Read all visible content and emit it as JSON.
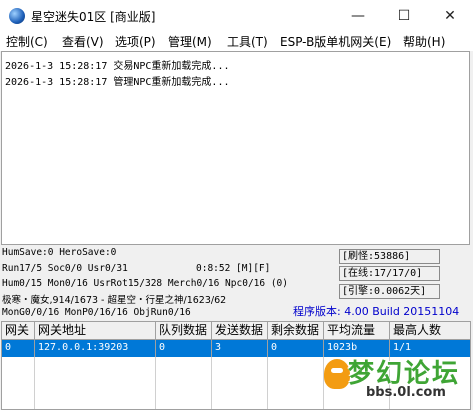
{
  "window": {
    "title": "星空迷失01区 [商业版]",
    "minimize_glyph": "—",
    "maximize_glyph": "☐",
    "close_glyph": "✕"
  },
  "menu": [
    {
      "label": "控制(C)"
    },
    {
      "label": "查看(V)"
    },
    {
      "label": "选项(P)"
    },
    {
      "label": "管理(M)"
    },
    {
      "label": "工具(T)"
    },
    {
      "label": "ESP-B版单机网关(E)"
    },
    {
      "label": "帮助(H)"
    }
  ],
  "log": [
    "2026-1-3 15:28:17 交易NPC重新加载完成...",
    "2026-1-3 15:28:17 管理NPC重新加载完成..."
  ],
  "status": {
    "line1": "HumSave:0 HeroSave:0",
    "line2": "Run17/5 Soc0/0 Usr0/31",
    "line2_time": "0:8:52 [M][F]",
    "line3": "Hum0/15 Mon0/16 UsrRot15/328 Merch0/16 Npc0/16 (0)",
    "line4": "极寒・魔女,914/1673 - 超星空・行星之神/1623/62",
    "line5": "MonG0/0/16 MonP0/16/16 ObjRun0/16",
    "refresh_monster": "[刷怪:53886]",
    "online": "[在线:17/17/0]",
    "engine": "[引擎:0.0062天]",
    "version": "程序版本: 4.00 Build 20151104"
  },
  "gateway_table": {
    "headers": [
      "网关",
      "网关地址",
      "队列数据",
      "发送数据",
      "剩余数据",
      "平均流量",
      "最高人数"
    ],
    "rows": [
      [
        "0",
        "127.0.0.1:39203",
        "0",
        "3",
        "0",
        "1023b",
        "1/1"
      ]
    ]
  },
  "watermark": {
    "main": "梦幻论坛",
    "sub": "bbs.0l.com"
  },
  "colors": {
    "selection": "#0078d7",
    "version_text": "#0000cc"
  },
  "icons": {
    "app": "app-globe-icon"
  }
}
